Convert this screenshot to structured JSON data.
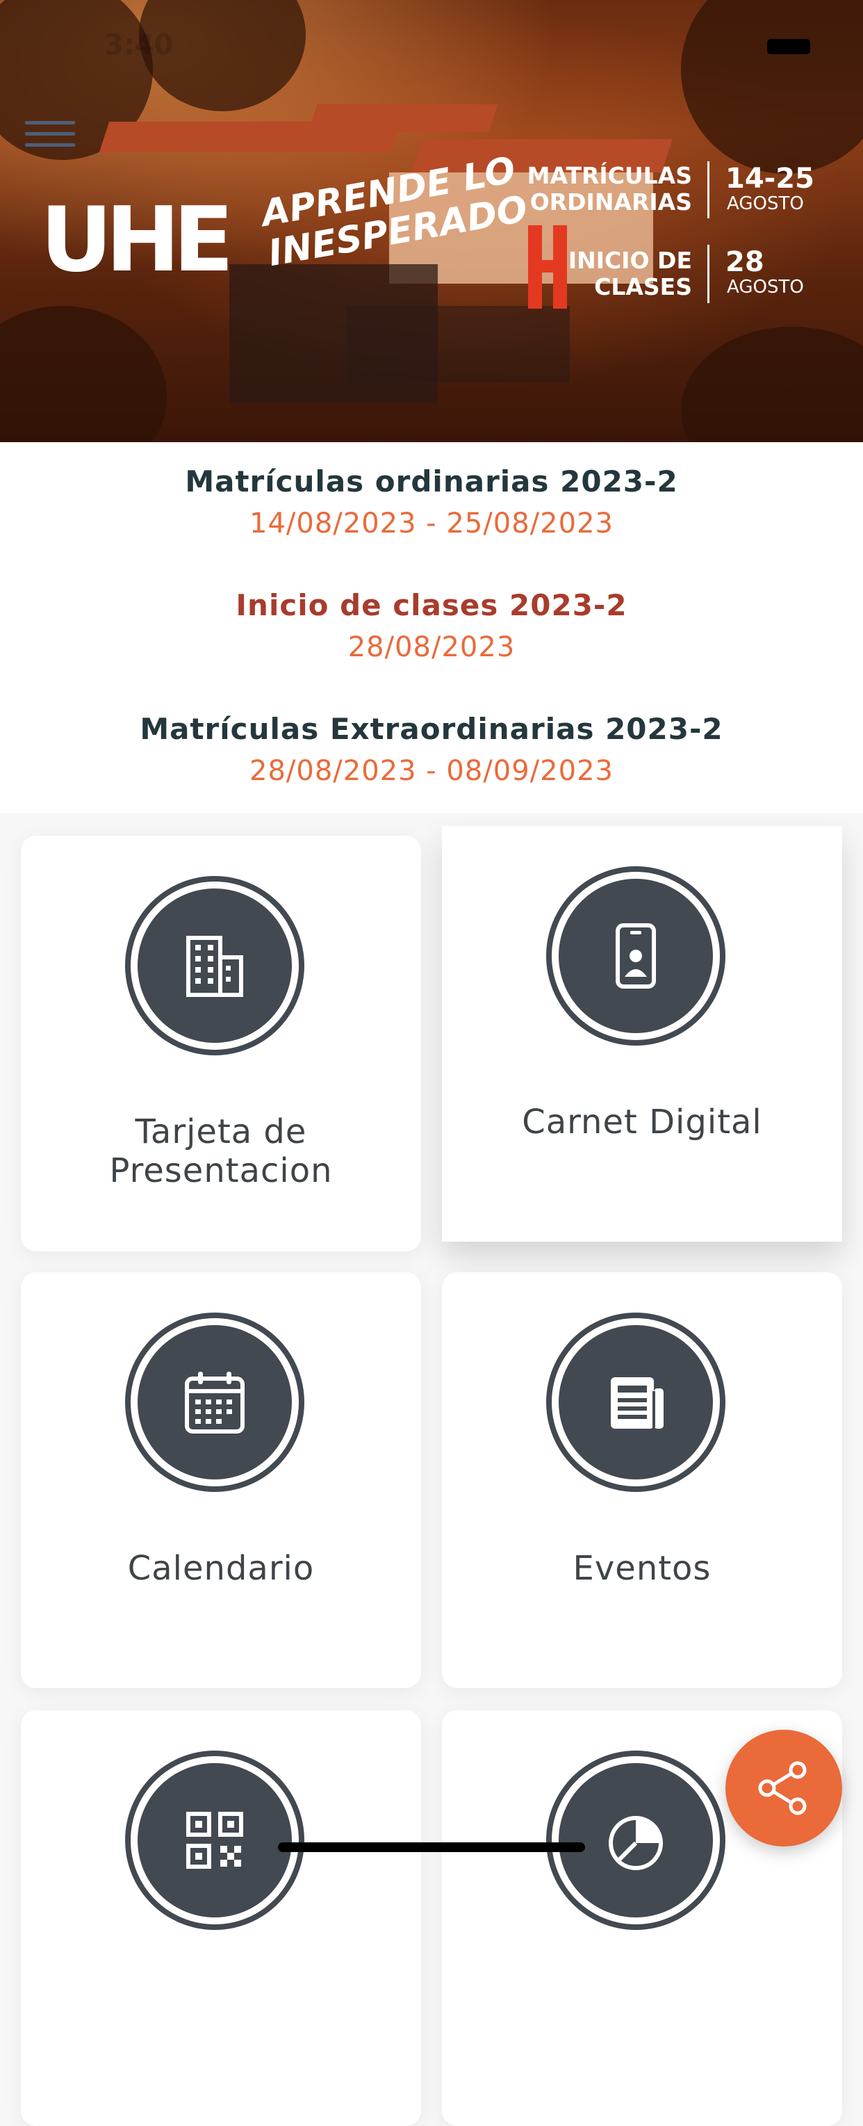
{
  "status_bar": {
    "time": "3:40"
  },
  "banner": {
    "logo_text": "UHE",
    "slogan_line1": "APRENDE LO",
    "slogan_line2": "INESPERADO",
    "promo": [
      {
        "label_line1": "MATRÍCULAS",
        "label_line2": "ORDINARIAS",
        "number": "14-25",
        "month": "AGOSTO"
      },
      {
        "label_line1": "INICIO DE",
        "label_line2": "CLASES",
        "number": "28",
        "month": "AGOSTO"
      }
    ]
  },
  "announcements": [
    {
      "title": "Matrículas ordinarias 2023-2",
      "date": "14/08/2023 - 25/08/2023"
    },
    {
      "title": "Inicio de clases 2023-2",
      "date": "28/08/2023"
    },
    {
      "title": "Matrículas Extraordinarias 2023-2",
      "date": "28/08/2023 - 08/09/2023"
    }
  ],
  "tiles": [
    {
      "label": "Tarjeta de Presentacion",
      "icon": "building-icon"
    },
    {
      "label": "Carnet Digital",
      "icon": "id-card-phone-icon"
    },
    {
      "label": "Calendario",
      "icon": "calendar-icon"
    },
    {
      "label": "Eventos",
      "icon": "newspaper-icon"
    },
    {
      "label": "",
      "icon": "qr-code-icon"
    },
    {
      "label": "",
      "icon": "pie-chart-icon"
    }
  ],
  "colors": {
    "accent_orange": "#ea6a3a",
    "title_dark": "#24373d",
    "title_red": "#a83c2c",
    "icon_circle": "#424950"
  }
}
